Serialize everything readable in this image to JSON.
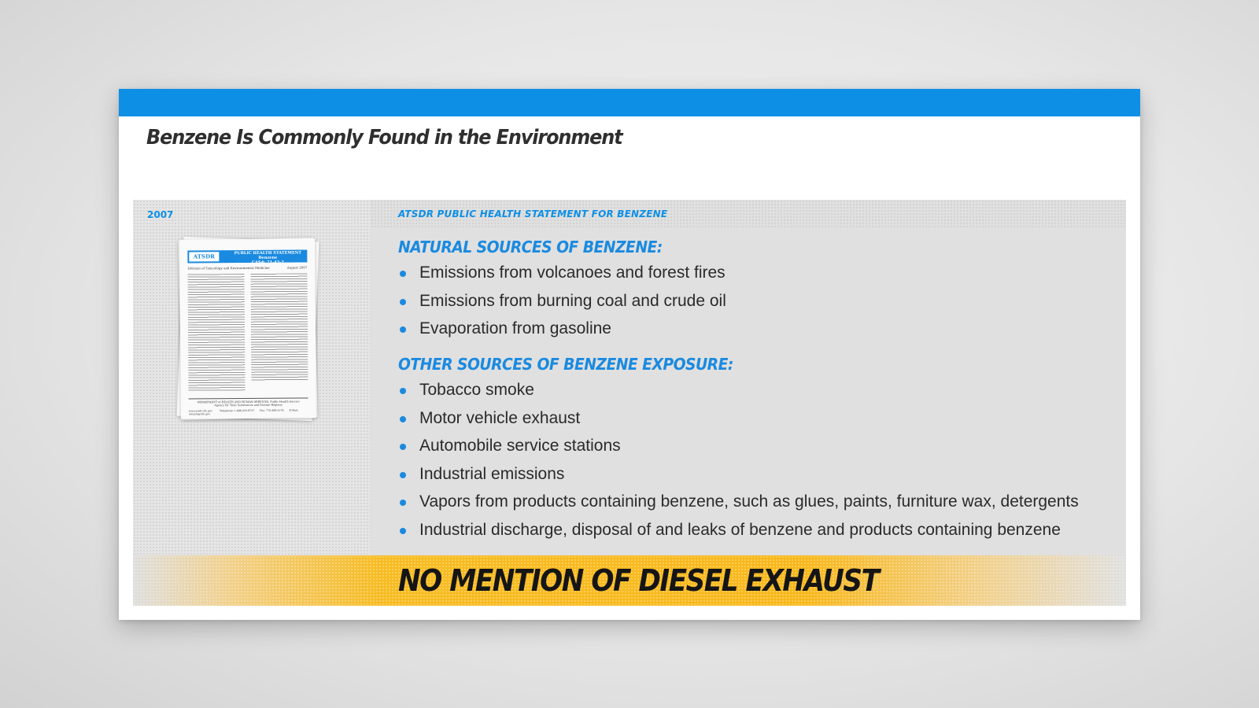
{
  "slide": {
    "title": "Benzene Is Commonly Found in the Environment",
    "accent_color": "#0d8fe6",
    "highlight_color": "#f8b81c"
  },
  "document": {
    "year": "2007",
    "logo_text": "ATSDR",
    "header_title": "PUBLIC HEALTH STATEMENT",
    "header_subject": "Benzene",
    "header_cas": "CAS#: 71-43-2",
    "subhead_left": "Division of Toxicology and Environmental Medicine",
    "subhead_right": "August 2007",
    "footer_line1": "DEPARTMENT of HEALTH AND HUMAN SERVICES, Public Health Service",
    "footer_line2": "Agency for Toxic Substances and Disease Registry",
    "footer_web": "www.atsdr.cdc.gov",
    "footer_phone": "Telephone: 1-888-422-8737",
    "footer_fax": "Fax: 770-488-4178",
    "footer_email": "E-Mail: cdcinfo@cdc.gov"
  },
  "content": {
    "source_label": "ATSDR PUBLIC HEALTH STATEMENT FOR BENZENE",
    "natural_heading": "NATURAL SOURCES OF BENZENE:",
    "natural_items": [
      "Emissions from volcanoes and forest fires",
      "Emissions from burning coal and crude oil",
      "Evaporation from gasoline"
    ],
    "other_heading": "OTHER SOURCES OF BENZENE EXPOSURE:",
    "other_items": [
      "Tobacco smoke",
      "Motor vehicle exhaust",
      "Automobile service stations",
      "Industrial emissions",
      "Vapors from products containing benzene, such as glues, paints, furniture wax, detergents",
      "Industrial discharge, disposal of and leaks of benzene and products containing benzene"
    ]
  },
  "callout": {
    "text": "NO MENTION OF DIESEL EXHAUST"
  }
}
